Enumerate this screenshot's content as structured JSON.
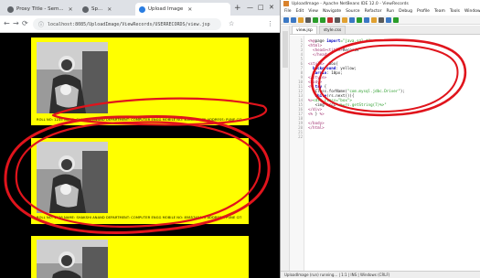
{
  "browser": {
    "tabs": [
      {
        "label": "Proxy Title - Sem...",
        "active": false
      },
      {
        "label": "Sp...",
        "active": false
      },
      {
        "label": "Upload Image",
        "active": true
      }
    ],
    "newtab_glyph": "+",
    "window_controls": {
      "minimize": "—",
      "maximize": "□",
      "close": "✕"
    },
    "nav": {
      "back": "←",
      "forward": "→",
      "reload": "⟳"
    },
    "address": {
      "lock_glyph": "ⓘ",
      "url": "localhost:8085/UploadImage/ViewRecords/USERRECORDS/view.jsp"
    },
    "extensions": [
      "☆",
      "⋮"
    ],
    "cards": [
      {
        "caption": "ROLL NO: 1235 NAME: SHAKSHI ANAND DEPARTMENT: COMPUTER ENGG MOBILE NO: 8585745675 ADDRESS: PUNE CITY MAHARASHTRA"
      },
      {
        "caption": "ROLL NO: 1236 NAME: SHAKSHI ANAND DEPARTMENT: COMPUTER ENGG MOBILE NO: 8585745675 ADDRESS: PUNE CITY MAHARASHTRA"
      },
      {
        "caption": ""
      }
    ]
  },
  "ide": {
    "title": "UploadImage - Apache NetBeans IDE 12.0 - ViewRecords",
    "menu": [
      "File",
      "Edit",
      "View",
      "Navigate",
      "Source",
      "Refactor",
      "Run",
      "Debug",
      "Profile",
      "Team",
      "Tools",
      "Window",
      "Help"
    ],
    "toolbar_colors": [
      "#3b78c4",
      "#3b78c4",
      "#e0a030",
      "#5a5a5a",
      "#2a9d2a",
      "#2a9d2a",
      "#c03030",
      "#5a5a5a",
      "#e0a030",
      "#3b78c4",
      "#2a9d2a",
      "#3b78c4",
      "#e0a030",
      "#5a5a5a",
      "#3b78c4",
      "#2a9d2a"
    ],
    "editor_tabs": [
      {
        "label": "view.jsp",
        "active": true
      },
      {
        "label": "style.css",
        "active": false
      }
    ],
    "line_numbers": [
      "1",
      "2",
      "3",
      "4",
      "5",
      "6",
      "7",
      "8",
      "9",
      "10",
      "11",
      "12",
      "13",
      "14",
      "15",
      "16",
      "17",
      "18",
      "19",
      "20",
      "21",
      "22"
    ],
    "code_lines": [
      [
        {
          "c": "tg",
          "t": "<%@"
        },
        {
          "c": "pl",
          "t": "page "
        },
        {
          "c": "kw",
          "t": "import"
        },
        {
          "c": "st",
          "t": "=\"java.sql.*\""
        },
        {
          "c": "tg",
          "t": "%>"
        }
      ],
      [
        {
          "c": "tg",
          "t": "<html>"
        }
      ],
      [
        {
          "c": "tg",
          "t": "  <head>"
        },
        {
          "c": "tg",
          "t": "<title>"
        },
        {
          "c": "pl",
          "t": "Records"
        }
      ],
      [
        {
          "c": "tg",
          "t": "  </head>"
        }
      ],
      [
        {
          "c": "pl",
          "t": ""
        }
      ],
      [
        {
          "c": "tg",
          "t": "<style>"
        },
        {
          "c": "pl",
          "t": " .box{"
        }
      ],
      [
        {
          "c": "pl",
          "t": "  "
        },
        {
          "c": "kw",
          "t": "background"
        },
        {
          "c": "pl",
          "t": ": yellow;"
        }
      ],
      [
        {
          "c": "pl",
          "t": "  "
        },
        {
          "c": "kw",
          "t": "margin"
        },
        {
          "c": "pl",
          "t": ": 10px;"
        }
      ],
      [
        {
          "c": "tg",
          "t": "</style>"
        }
      ],
      [
        {
          "c": "tg",
          "t": "<body>"
        },
        {
          "c": "pl",
          "t": ""
        }
      ],
      [
        {
          "c": "tg",
          "t": "<%"
        },
        {
          "c": "pl",
          "t": " "
        },
        {
          "c": "kw",
          "t": "try"
        },
        {
          "c": "pl",
          "t": " {"
        }
      ],
      [
        {
          "c": "pl",
          "t": "   Class.forName("
        },
        {
          "c": "st",
          "t": "\"com.mysql.jdbc.Driver\""
        },
        {
          "c": "pl",
          "t": ");"
        }
      ],
      [
        {
          "c": "pl",
          "t": "   "
        },
        {
          "c": "kw",
          "t": "while"
        },
        {
          "c": "pl",
          "t": "(rs.next()){"
        }
      ],
      [
        {
          "c": "tg",
          "t": "%>"
        },
        {
          "c": "st",
          "t": "<div class=\"box\">"
        }
      ],
      [
        {
          "c": "pl",
          "t": "   <img src="
        },
        {
          "c": "st",
          "t": "\"<%=rs.getString(7)%>\""
        }
      ],
      [
        {
          "c": "tg",
          "t": "</div>"
        }
      ],
      [
        {
          "c": "tg",
          "t": "<%"
        },
        {
          "c": "pl",
          "t": " } "
        },
        {
          "c": "tg",
          "t": "%>"
        }
      ],
      [
        {
          "c": "pl",
          "t": ""
        }
      ],
      [
        {
          "c": "tg",
          "t": "</body>"
        }
      ],
      [
        {
          "c": "tg",
          "t": "</html>"
        }
      ],
      [
        {
          "c": "pl",
          "t": ""
        }
      ],
      [
        {
          "c": "pl",
          "t": ""
        }
      ]
    ],
    "status": "UploadImage (run) running...   |  1:1  |  INS  |  Windows (CRLF)"
  },
  "annotation_color": "#e0141c"
}
